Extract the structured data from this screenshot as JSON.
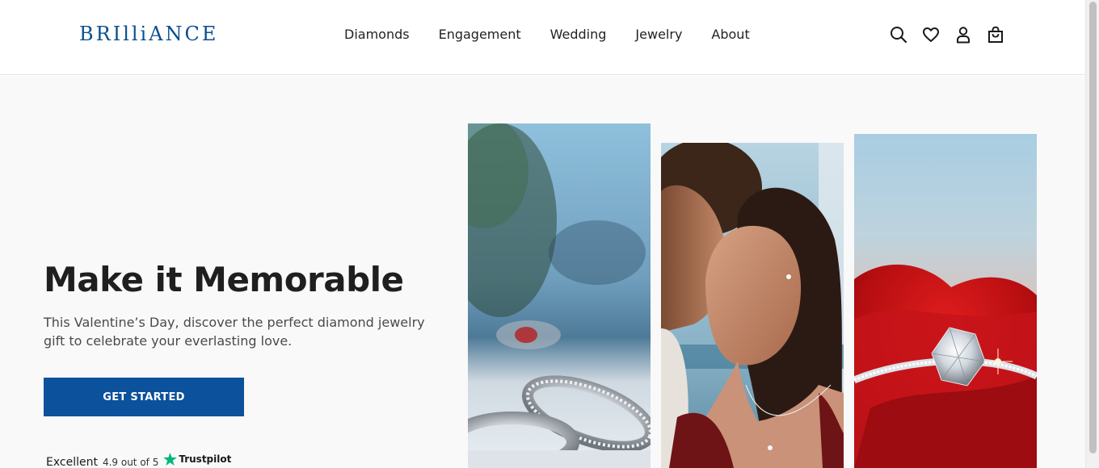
{
  "brand": {
    "logo_text": "BRIlliANCE",
    "color": "#0b4f8f"
  },
  "nav": {
    "items": [
      {
        "label": "Diamonds"
      },
      {
        "label": "Engagement"
      },
      {
        "label": "Wedding"
      },
      {
        "label": "Jewelry"
      },
      {
        "label": "About"
      }
    ]
  },
  "header_icons": [
    "search-icon",
    "heart-icon",
    "account-icon",
    "shopping-bag-icon"
  ],
  "hero": {
    "title": "Make it Memorable",
    "subtitle": "This Valentine’s Day, discover the perfect diamond jewelry gift to celebrate your everlasting love.",
    "cta_label": "GET STARTED",
    "cta_color": "#0b519c",
    "photos": [
      "wedding-bands-photo",
      "couple-kissing-photo",
      "diamond-ring-on-rose-photo"
    ]
  },
  "trust": {
    "rating_word": "Excellent",
    "score_text": "4.9 out of 5",
    "provider": "Trustpilot",
    "star_color": "#00b67a"
  }
}
